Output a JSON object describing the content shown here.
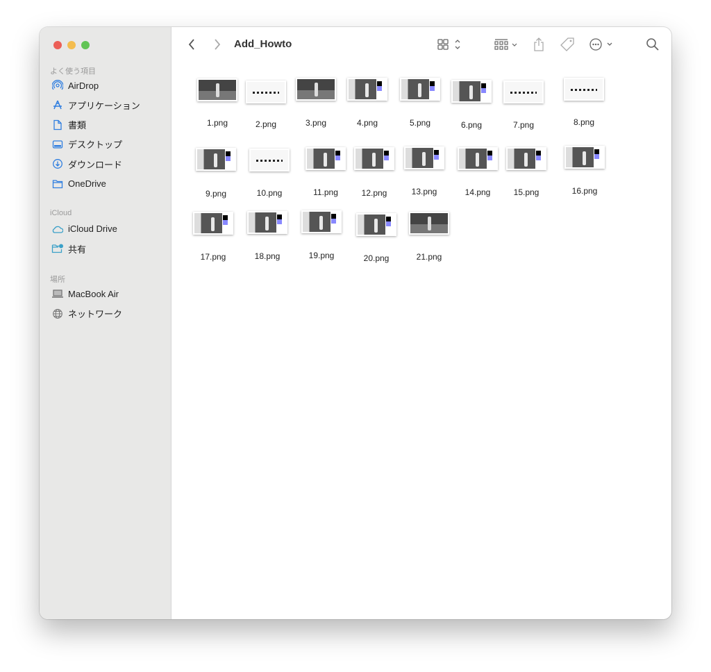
{
  "window": {
    "title": "Add_Howto"
  },
  "sidebar": {
    "sections": [
      {
        "header": "よく使う項目",
        "items": [
          {
            "label": "AirDrop",
            "icon": "airdrop-icon"
          },
          {
            "label": "アプリケーション",
            "icon": "applications-icon"
          },
          {
            "label": "書類",
            "icon": "document-icon"
          },
          {
            "label": "デスクトップ",
            "icon": "desktop-icon"
          },
          {
            "label": "ダウンロード",
            "icon": "download-icon"
          },
          {
            "label": "OneDrive",
            "icon": "folder-icon"
          }
        ]
      },
      {
        "header": "iCloud",
        "items": [
          {
            "label": "iCloud Drive",
            "icon": "cloud-icon"
          },
          {
            "label": "共有",
            "icon": "shared-folder-icon"
          }
        ]
      },
      {
        "header": "場所",
        "items": [
          {
            "label": "MacBook Air",
            "icon": "laptop-icon"
          },
          {
            "label": "ネットワーク",
            "icon": "network-icon"
          }
        ]
      }
    ]
  },
  "files": [
    "1.png",
    "2.png",
    "3.png",
    "4.png",
    "5.png",
    "6.png",
    "7.png",
    "8.png",
    "9.png",
    "10.png",
    "11.png",
    "12.png",
    "13.png",
    "14.png",
    "15.png",
    "16.png",
    "17.png",
    "18.png",
    "19.png",
    "20.png",
    "21.png"
  ],
  "colors": {
    "close": "#ec5f57",
    "minimize": "#f4bd4f",
    "zoom": "#61c454",
    "accent": "#2f7ee0"
  }
}
